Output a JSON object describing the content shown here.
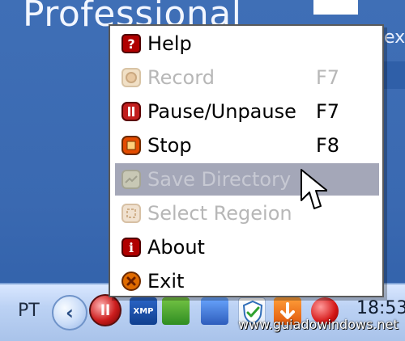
{
  "desktop": {
    "title_text": "Professional",
    "right_text": "ex"
  },
  "menu": {
    "items": [
      {
        "key": "help",
        "label": "Help",
        "shortcut": "",
        "enabled": true,
        "icon": "help-icon"
      },
      {
        "key": "record",
        "label": "Record",
        "shortcut": "F7",
        "enabled": false,
        "icon": "record-icon"
      },
      {
        "key": "pause",
        "label": "Pause/Unpause",
        "shortcut": "F7",
        "enabled": true,
        "icon": "pause-icon"
      },
      {
        "key": "stop",
        "label": "Stop",
        "shortcut": "F8",
        "enabled": true,
        "icon": "stop-icon"
      },
      {
        "key": "save_directory",
        "label": "Save Directory",
        "shortcut": "",
        "enabled": false,
        "icon": "save-directory-icon",
        "highlighted": true
      },
      {
        "key": "select_region",
        "label": "Select Regeion",
        "shortcut": "",
        "enabled": false,
        "icon": "select-region-icon"
      },
      {
        "key": "about",
        "label": "About",
        "shortcut": "",
        "enabled": true,
        "icon": "about-icon"
      },
      {
        "key": "exit",
        "label": "Exit",
        "shortcut": "",
        "enabled": true,
        "icon": "exit-icon"
      }
    ]
  },
  "taskbar": {
    "language": "PT",
    "tray_icons": [
      {
        "name": "pause-tray-icon",
        "text": "ll"
      },
      {
        "name": "xmp-tray-icon",
        "text": "XMP"
      },
      {
        "name": "f-tray-icon",
        "text": ""
      },
      {
        "name": "network-tray-icon",
        "text": ""
      },
      {
        "name": "shield-tray-icon",
        "text": ""
      },
      {
        "name": "orange-tray-icon",
        "text": ""
      },
      {
        "name": "red-tray-icon",
        "text": ""
      }
    ],
    "clock": "18:53",
    "watermark": "www.guiadowindows.net"
  },
  "colors": {
    "menu_highlight": "#a4a7b8",
    "disabled_text": "#b7b7b7"
  }
}
